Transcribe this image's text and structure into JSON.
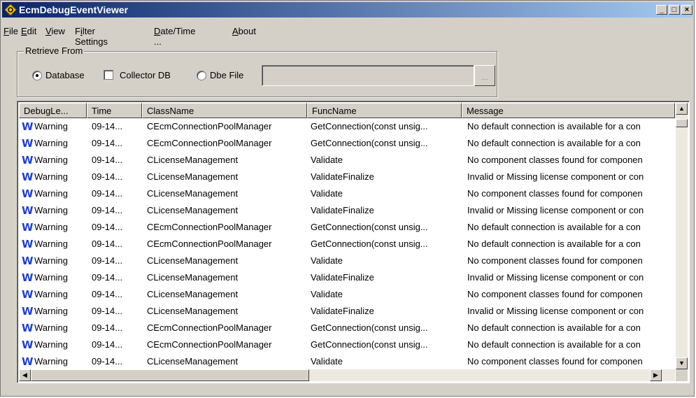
{
  "window": {
    "title": "EcmDebugEventViewer",
    "minimize": "_",
    "maximize": "□",
    "close": "×"
  },
  "menu": [
    {
      "label": "File",
      "underline": "F",
      "rest": "ile"
    },
    {
      "label": "Edit",
      "underline": "E",
      "rest": "dit"
    },
    {
      "label": "View",
      "underline": "V",
      "rest": "iew"
    },
    {
      "label": "Filter Settings",
      "pre": "F",
      "underline": "i",
      "rest": "lter Settings"
    },
    {
      "label": "Date/Time ...",
      "underline": "D",
      "rest": "ate/Time ..."
    },
    {
      "label": "About",
      "underline": "A",
      "rest": "bout"
    }
  ],
  "retrieve": {
    "group_label": "Retrieve From",
    "database_label": "Database",
    "database_checked": true,
    "collector_label": "Collector DB",
    "collector_checked": false,
    "dbefile_label": "Dbe File",
    "dbefile_checked": false,
    "path_value": "",
    "browse_label": "..."
  },
  "table": {
    "columns": [
      "DebugLe...",
      "Time",
      "ClassName",
      "FuncName",
      "Message"
    ],
    "rows": [
      {
        "level": "Warning",
        "time": "09-14...",
        "class": "CEcmConnectionPoolManager",
        "func": "GetConnection(const unsig...",
        "message": "No default connection is available for a con"
      },
      {
        "level": "Warning",
        "time": "09-14...",
        "class": "CEcmConnectionPoolManager",
        "func": "GetConnection(const unsig...",
        "message": "No default connection is available for a con"
      },
      {
        "level": "Warning",
        "time": "09-14...",
        "class": "CLicenseManagement",
        "func": "Validate",
        "message": "No component classes found for componen"
      },
      {
        "level": "Warning",
        "time": "09-14...",
        "class": "CLicenseManagement",
        "func": "ValidateFinalize",
        "message": "Invalid or Missing license component or con"
      },
      {
        "level": "Warning",
        "time": "09-14...",
        "class": "CLicenseManagement",
        "func": "Validate",
        "message": "No component classes found for componen"
      },
      {
        "level": "Warning",
        "time": "09-14...",
        "class": "CLicenseManagement",
        "func": "ValidateFinalize",
        "message": "Invalid or Missing license component or con"
      },
      {
        "level": "Warning",
        "time": "09-14...",
        "class": "CEcmConnectionPoolManager",
        "func": "GetConnection(const unsig...",
        "message": "No default connection is available for a con"
      },
      {
        "level": "Warning",
        "time": "09-14...",
        "class": "CEcmConnectionPoolManager",
        "func": "GetConnection(const unsig...",
        "message": "No default connection is available for a con"
      },
      {
        "level": "Warning",
        "time": "09-14...",
        "class": "CLicenseManagement",
        "func": "Validate",
        "message": "No component classes found for componen"
      },
      {
        "level": "Warning",
        "time": "09-14...",
        "class": "CLicenseManagement",
        "func": "ValidateFinalize",
        "message": "Invalid or Missing license component or con"
      },
      {
        "level": "Warning",
        "time": "09-14...",
        "class": "CLicenseManagement",
        "func": "Validate",
        "message": "No component classes found for componen"
      },
      {
        "level": "Warning",
        "time": "09-14...",
        "class": "CLicenseManagement",
        "func": "ValidateFinalize",
        "message": "Invalid or Missing license component or con"
      },
      {
        "level": "Warning",
        "time": "09-14...",
        "class": "CEcmConnectionPoolManager",
        "func": "GetConnection(const unsig...",
        "message": "No default connection is available for a con"
      },
      {
        "level": "Warning",
        "time": "09-14...",
        "class": "CEcmConnectionPoolManager",
        "func": "GetConnection(const unsig...",
        "message": "No default connection is available for a con"
      },
      {
        "level": "Warning",
        "time": "09-14...",
        "class": "CLicenseManagement",
        "func": "Validate",
        "message": "No component classes found for componen"
      }
    ]
  },
  "icons": {
    "app": "app-diamond-icon",
    "warning": "warning-w-icon"
  },
  "colors": {
    "titlebar_start": "#0a246a",
    "titlebar_end": "#a6caf0",
    "warning_icon": "#1d3fd8",
    "app_icon": "#f5c400"
  }
}
